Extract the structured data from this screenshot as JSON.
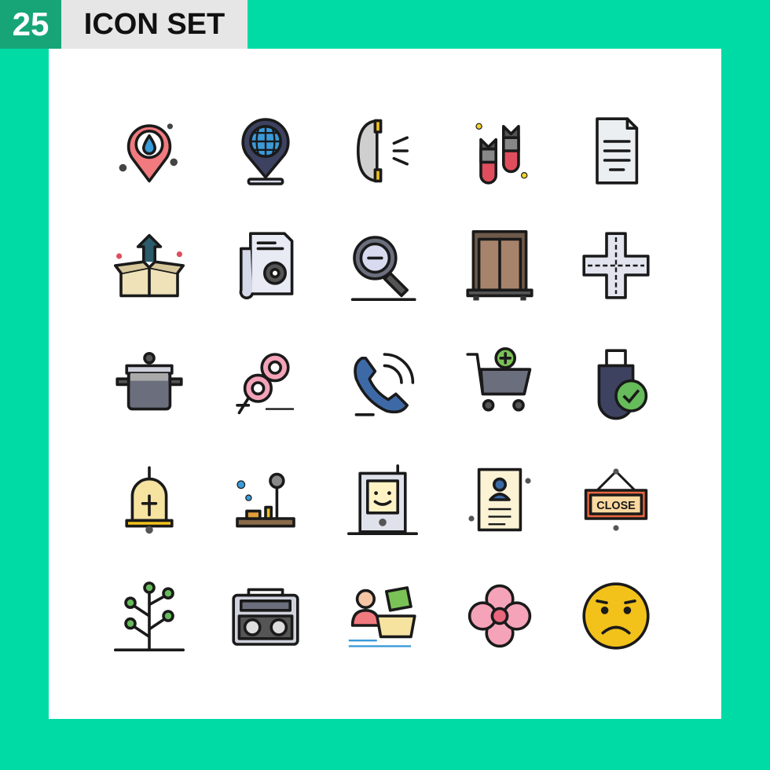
{
  "header": {
    "count": "25",
    "title": "ICON SET"
  },
  "colors": {
    "background": "#00dba6",
    "badge": "#17a578",
    "title_bg": "#e6e6e6",
    "panel": "#ffffff",
    "outline": "#1a1a1a"
  },
  "icons": [
    "water-location-pin-icon",
    "globe-location-pin-icon",
    "telephone-ringing-icon",
    "bombs-icon",
    "document-icon",
    "box-upload-icon",
    "settings-document-icon",
    "zoom-out-icon",
    "door-icon",
    "crossroad-icon",
    "cooking-pot-icon",
    "female-gender-icon",
    "phone-call-icon",
    "add-to-cart-icon",
    "usb-verified-icon",
    "bell-icon",
    "joystick-icon",
    "smiling-tablet-icon",
    "resume-profile-icon",
    "close-sign-icon",
    "tree-icon",
    "radio-cassette-icon",
    "shopping-basket-money-icon",
    "flower-icon",
    "sad-emoji-icon"
  ],
  "close_sign": {
    "label": "CLOSE"
  }
}
